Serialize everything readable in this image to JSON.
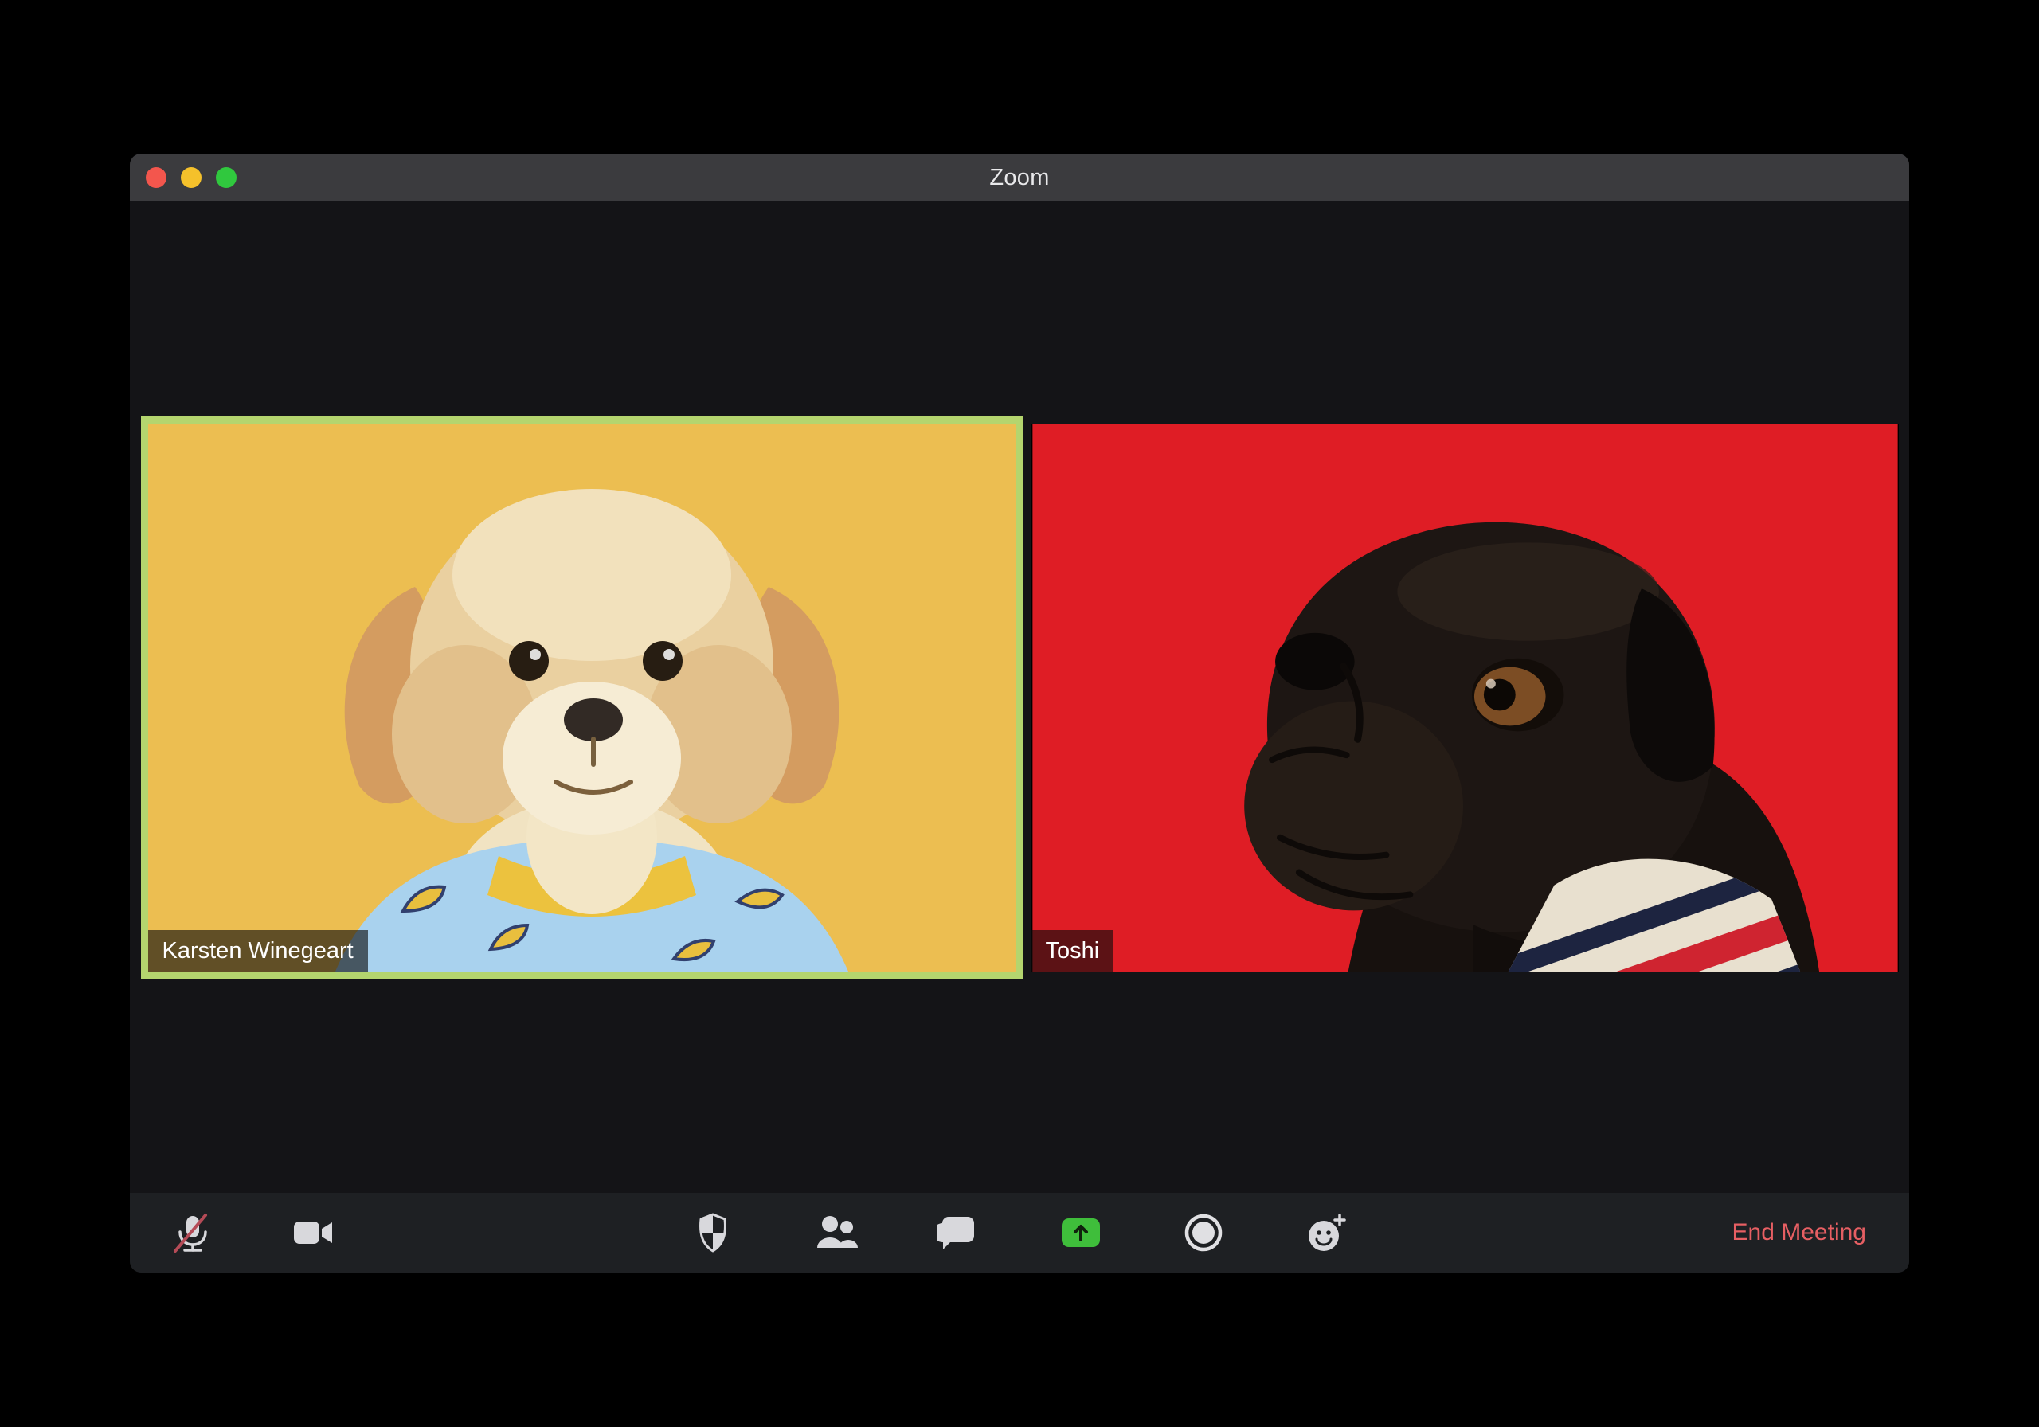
{
  "window": {
    "title": "Zoom",
    "traffic_lights": [
      "close",
      "minimize",
      "fullscreen"
    ]
  },
  "meeting": {
    "participants": [
      {
        "name": "Karsten Winegeart",
        "active_speaker": true,
        "video_bg": "#ecbe51",
        "video_subject": "tan-fluffy-dog-in-blue-banana-shirt"
      },
      {
        "name": "Toshi",
        "active_speaker": false,
        "video_bg": "#df1d25",
        "video_subject": "black-pug-in-striped-sweater"
      }
    ]
  },
  "toolbar": {
    "icons": [
      {
        "id": "mute-microphone",
        "state": "muted"
      },
      {
        "id": "video-camera",
        "state": "on"
      },
      {
        "id": "security-shield"
      },
      {
        "id": "participants"
      },
      {
        "id": "chat"
      },
      {
        "id": "share-screen",
        "style": "green-button"
      },
      {
        "id": "record"
      },
      {
        "id": "reactions"
      }
    ],
    "end_meeting_label": "End Meeting"
  },
  "colors": {
    "window_bg": "#151518",
    "titlebar_bg": "#3b3b3e",
    "toolbar_bg": "#1e2023",
    "active_speaker_border": "#b4d56e",
    "share_green": "#3fbe3b",
    "end_meeting_red": "#e75f63",
    "icon_gray": "#d8d8dc",
    "mute_slash_red": "#b54b57",
    "tile_karsten_bg": "#ecbe51",
    "tile_toshi_bg": "#df1d25",
    "traffic_red": "#f3564d",
    "traffic_yellow": "#f5c12b",
    "traffic_green": "#30c83e"
  }
}
